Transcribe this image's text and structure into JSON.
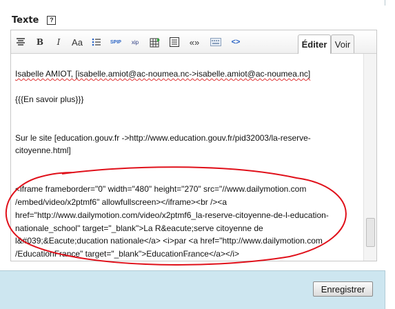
{
  "field": {
    "label": "Texte",
    "help_glyph": "?"
  },
  "toolbar": {
    "buttons": [
      {
        "name": "align-center-icon"
      },
      {
        "name": "bold-button",
        "glyph": "B"
      },
      {
        "name": "italic-button",
        "glyph": "I"
      },
      {
        "name": "font-size-button",
        "glyph": "Aa"
      },
      {
        "name": "bullet-list-icon"
      },
      {
        "name": "insert-link-button",
        "glyph": "SPIP"
      },
      {
        "name": "insert-anchor-button",
        "glyph": "xip"
      },
      {
        "name": "insert-table-icon"
      },
      {
        "name": "paragraph-icon"
      },
      {
        "name": "quote-button",
        "glyph": "«»"
      },
      {
        "name": "keyboard-icon"
      },
      {
        "name": "code-icon",
        "glyph": "<>"
      }
    ]
  },
  "tabs": [
    {
      "label": "Éditer",
      "active": true
    },
    {
      "label": "Voir",
      "active": false
    }
  ],
  "content": {
    "line1": "Isabelle AMIOT, [isabelle.amiot@ac-noumea.nc->isabelle.amiot@ac-noumea.nc]",
    "line2": "{{{En savoir plus}}}",
    "line3a": "Sur le site [education.gouv.fr ->http://www.education.gouv.fr/pid32003/la-reserve-",
    "line3b": "citoyenne.html]",
    "iframe_lines": [
      "<iframe frameborder=\"0\" width=\"480\" height=\"270\" src=\"//www.dailymotion.com",
      "/embed/video/x2ptmf6\" allowfullscreen></iframe><br /><a",
      "href=\"http://www.dailymotion.com/video/x2ptmf6_la-reserve-citoyenne-de-l-education-",
      "nationale_school\" target=\"_blank\">La R&eacute;serve citoyenne de",
      "l&#039;&Eacute;ducation nationale</a> <i>par <a href=\"http://www.dailymotion.com",
      "/EducationFrance\" target=\"_blank\">EducationFrance</a></i>"
    ]
  },
  "actions": {
    "save_label": "Enregistrer"
  },
  "colors": {
    "annotation": "#e0101a",
    "panel": "#cde6f0"
  }
}
